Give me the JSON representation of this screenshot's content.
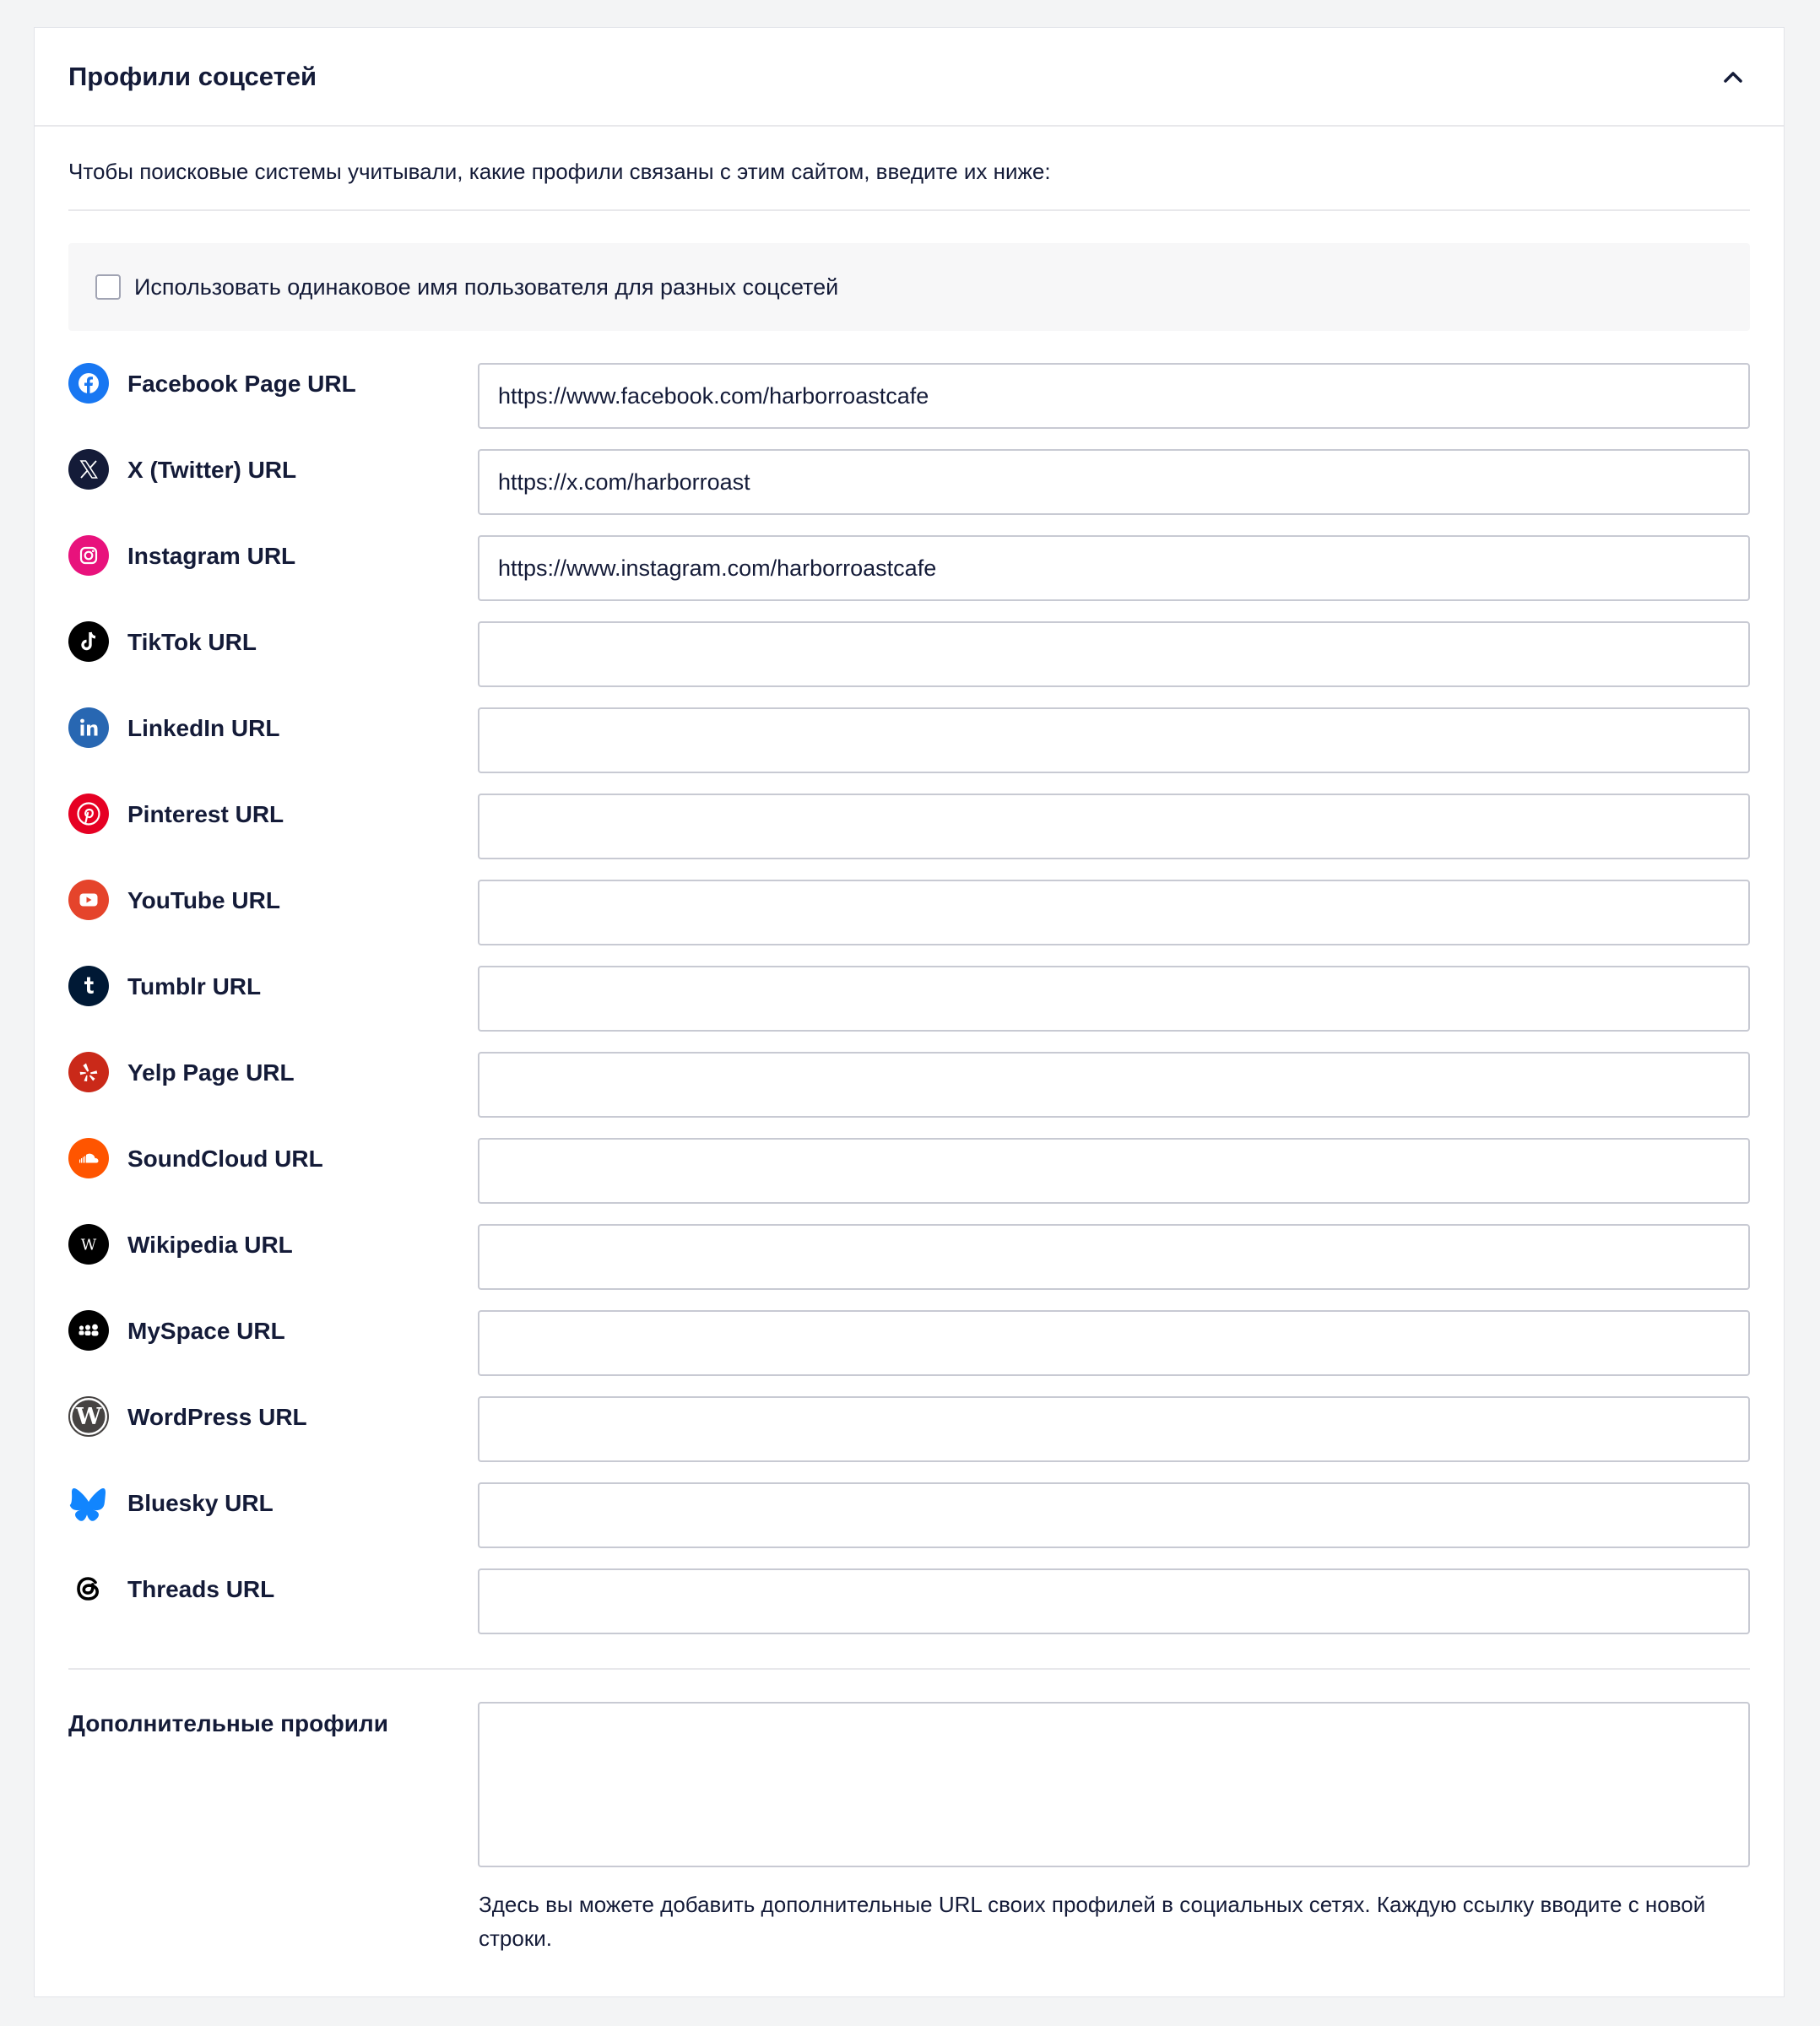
{
  "panel": {
    "title": "Профили соцсетей",
    "description": "Чтобы поисковые системы учитывали, какие профили связаны с этим сайтом, введите их ниже:",
    "same_username_label": "Использовать одинаковое имя пользователя для разных соцсетей",
    "same_username_checked": false
  },
  "profiles": [
    {
      "label": "Facebook Page URL",
      "value": "https://www.facebook.com/harborroastcafe",
      "icon": "facebook-icon",
      "color": "#1877f2"
    },
    {
      "label": "X (Twitter) URL",
      "value": "https://x.com/harborroast",
      "icon": "x-twitter-icon",
      "color": "#141b38"
    },
    {
      "label": "Instagram URL",
      "value": "https://www.instagram.com/harborroastcafe",
      "icon": "instagram-icon",
      "color": "#e1306c"
    },
    {
      "label": "TikTok URL",
      "value": "",
      "icon": "tiktok-icon",
      "color": "#000000"
    },
    {
      "label": "LinkedIn URL",
      "value": "",
      "icon": "linkedin-icon",
      "color": "#2867b2"
    },
    {
      "label": "Pinterest URL",
      "value": "",
      "icon": "pinterest-icon",
      "color": "#e60023"
    },
    {
      "label": "YouTube URL",
      "value": "",
      "icon": "youtube-icon",
      "color": "#e5442b"
    },
    {
      "label": "Tumblr URL",
      "value": "",
      "icon": "tumblr-icon",
      "color": "#001935"
    },
    {
      "label": "Yelp Page URL",
      "value": "",
      "icon": "yelp-icon",
      "color": "#d32323"
    },
    {
      "label": "SoundCloud URL",
      "value": "",
      "icon": "soundcloud-icon",
      "color": "#ff5500"
    },
    {
      "label": "Wikipedia URL",
      "value": "",
      "icon": "wikipedia-icon",
      "color": "#000000"
    },
    {
      "label": "MySpace URL",
      "value": "",
      "icon": "myspace-icon",
      "color": "#000000"
    },
    {
      "label": "WordPress URL",
      "value": "",
      "icon": "wordpress-icon",
      "color": "#21759b"
    },
    {
      "label": "Bluesky URL",
      "value": "",
      "icon": "bluesky-icon",
      "color": "#1185fe"
    },
    {
      "label": "Threads URL",
      "value": "",
      "icon": "threads-icon",
      "color": "#000000"
    }
  ],
  "additional": {
    "label": "Дополнительные профили",
    "value": "",
    "help": "Здесь вы можете добавить дополнительные URL своих профилей в социальных сетях. Каждую ссылку вводите с новой строки."
  }
}
